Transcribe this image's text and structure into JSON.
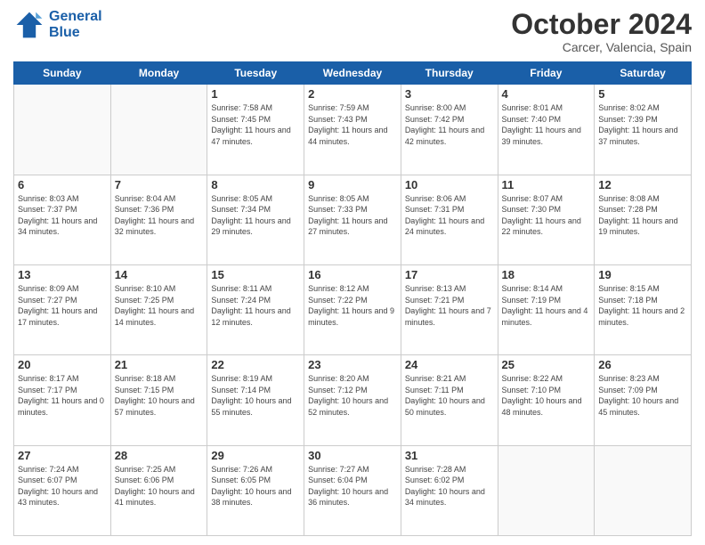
{
  "logo": {
    "line1": "General",
    "line2": "Blue"
  },
  "title": "October 2024",
  "subtitle": "Carcer, Valencia, Spain",
  "days_header": [
    "Sunday",
    "Monday",
    "Tuesday",
    "Wednesday",
    "Thursday",
    "Friday",
    "Saturday"
  ],
  "weeks": [
    [
      {
        "day": "",
        "sunrise": "",
        "sunset": "",
        "daylight": ""
      },
      {
        "day": "",
        "sunrise": "",
        "sunset": "",
        "daylight": ""
      },
      {
        "day": "1",
        "sunrise": "Sunrise: 7:58 AM",
        "sunset": "Sunset: 7:45 PM",
        "daylight": "Daylight: 11 hours and 47 minutes."
      },
      {
        "day": "2",
        "sunrise": "Sunrise: 7:59 AM",
        "sunset": "Sunset: 7:43 PM",
        "daylight": "Daylight: 11 hours and 44 minutes."
      },
      {
        "day": "3",
        "sunrise": "Sunrise: 8:00 AM",
        "sunset": "Sunset: 7:42 PM",
        "daylight": "Daylight: 11 hours and 42 minutes."
      },
      {
        "day": "4",
        "sunrise": "Sunrise: 8:01 AM",
        "sunset": "Sunset: 7:40 PM",
        "daylight": "Daylight: 11 hours and 39 minutes."
      },
      {
        "day": "5",
        "sunrise": "Sunrise: 8:02 AM",
        "sunset": "Sunset: 7:39 PM",
        "daylight": "Daylight: 11 hours and 37 minutes."
      }
    ],
    [
      {
        "day": "6",
        "sunrise": "Sunrise: 8:03 AM",
        "sunset": "Sunset: 7:37 PM",
        "daylight": "Daylight: 11 hours and 34 minutes."
      },
      {
        "day": "7",
        "sunrise": "Sunrise: 8:04 AM",
        "sunset": "Sunset: 7:36 PM",
        "daylight": "Daylight: 11 hours and 32 minutes."
      },
      {
        "day": "8",
        "sunrise": "Sunrise: 8:05 AM",
        "sunset": "Sunset: 7:34 PM",
        "daylight": "Daylight: 11 hours and 29 minutes."
      },
      {
        "day": "9",
        "sunrise": "Sunrise: 8:05 AM",
        "sunset": "Sunset: 7:33 PM",
        "daylight": "Daylight: 11 hours and 27 minutes."
      },
      {
        "day": "10",
        "sunrise": "Sunrise: 8:06 AM",
        "sunset": "Sunset: 7:31 PM",
        "daylight": "Daylight: 11 hours and 24 minutes."
      },
      {
        "day": "11",
        "sunrise": "Sunrise: 8:07 AM",
        "sunset": "Sunset: 7:30 PM",
        "daylight": "Daylight: 11 hours and 22 minutes."
      },
      {
        "day": "12",
        "sunrise": "Sunrise: 8:08 AM",
        "sunset": "Sunset: 7:28 PM",
        "daylight": "Daylight: 11 hours and 19 minutes."
      }
    ],
    [
      {
        "day": "13",
        "sunrise": "Sunrise: 8:09 AM",
        "sunset": "Sunset: 7:27 PM",
        "daylight": "Daylight: 11 hours and 17 minutes."
      },
      {
        "day": "14",
        "sunrise": "Sunrise: 8:10 AM",
        "sunset": "Sunset: 7:25 PM",
        "daylight": "Daylight: 11 hours and 14 minutes."
      },
      {
        "day": "15",
        "sunrise": "Sunrise: 8:11 AM",
        "sunset": "Sunset: 7:24 PM",
        "daylight": "Daylight: 11 hours and 12 minutes."
      },
      {
        "day": "16",
        "sunrise": "Sunrise: 8:12 AM",
        "sunset": "Sunset: 7:22 PM",
        "daylight": "Daylight: 11 hours and 9 minutes."
      },
      {
        "day": "17",
        "sunrise": "Sunrise: 8:13 AM",
        "sunset": "Sunset: 7:21 PM",
        "daylight": "Daylight: 11 hours and 7 minutes."
      },
      {
        "day": "18",
        "sunrise": "Sunrise: 8:14 AM",
        "sunset": "Sunset: 7:19 PM",
        "daylight": "Daylight: 11 hours and 4 minutes."
      },
      {
        "day": "19",
        "sunrise": "Sunrise: 8:15 AM",
        "sunset": "Sunset: 7:18 PM",
        "daylight": "Daylight: 11 hours and 2 minutes."
      }
    ],
    [
      {
        "day": "20",
        "sunrise": "Sunrise: 8:17 AM",
        "sunset": "Sunset: 7:17 PM",
        "daylight": "Daylight: 11 hours and 0 minutes."
      },
      {
        "day": "21",
        "sunrise": "Sunrise: 8:18 AM",
        "sunset": "Sunset: 7:15 PM",
        "daylight": "Daylight: 10 hours and 57 minutes."
      },
      {
        "day": "22",
        "sunrise": "Sunrise: 8:19 AM",
        "sunset": "Sunset: 7:14 PM",
        "daylight": "Daylight: 10 hours and 55 minutes."
      },
      {
        "day": "23",
        "sunrise": "Sunrise: 8:20 AM",
        "sunset": "Sunset: 7:12 PM",
        "daylight": "Daylight: 10 hours and 52 minutes."
      },
      {
        "day": "24",
        "sunrise": "Sunrise: 8:21 AM",
        "sunset": "Sunset: 7:11 PM",
        "daylight": "Daylight: 10 hours and 50 minutes."
      },
      {
        "day": "25",
        "sunrise": "Sunrise: 8:22 AM",
        "sunset": "Sunset: 7:10 PM",
        "daylight": "Daylight: 10 hours and 48 minutes."
      },
      {
        "day": "26",
        "sunrise": "Sunrise: 8:23 AM",
        "sunset": "Sunset: 7:09 PM",
        "daylight": "Daylight: 10 hours and 45 minutes."
      }
    ],
    [
      {
        "day": "27",
        "sunrise": "Sunrise: 7:24 AM",
        "sunset": "Sunset: 6:07 PM",
        "daylight": "Daylight: 10 hours and 43 minutes."
      },
      {
        "day": "28",
        "sunrise": "Sunrise: 7:25 AM",
        "sunset": "Sunset: 6:06 PM",
        "daylight": "Daylight: 10 hours and 41 minutes."
      },
      {
        "day": "29",
        "sunrise": "Sunrise: 7:26 AM",
        "sunset": "Sunset: 6:05 PM",
        "daylight": "Daylight: 10 hours and 38 minutes."
      },
      {
        "day": "30",
        "sunrise": "Sunrise: 7:27 AM",
        "sunset": "Sunset: 6:04 PM",
        "daylight": "Daylight: 10 hours and 36 minutes."
      },
      {
        "day": "31",
        "sunrise": "Sunrise: 7:28 AM",
        "sunset": "Sunset: 6:02 PM",
        "daylight": "Daylight: 10 hours and 34 minutes."
      },
      {
        "day": "",
        "sunrise": "",
        "sunset": "",
        "daylight": ""
      },
      {
        "day": "",
        "sunrise": "",
        "sunset": "",
        "daylight": ""
      }
    ]
  ]
}
